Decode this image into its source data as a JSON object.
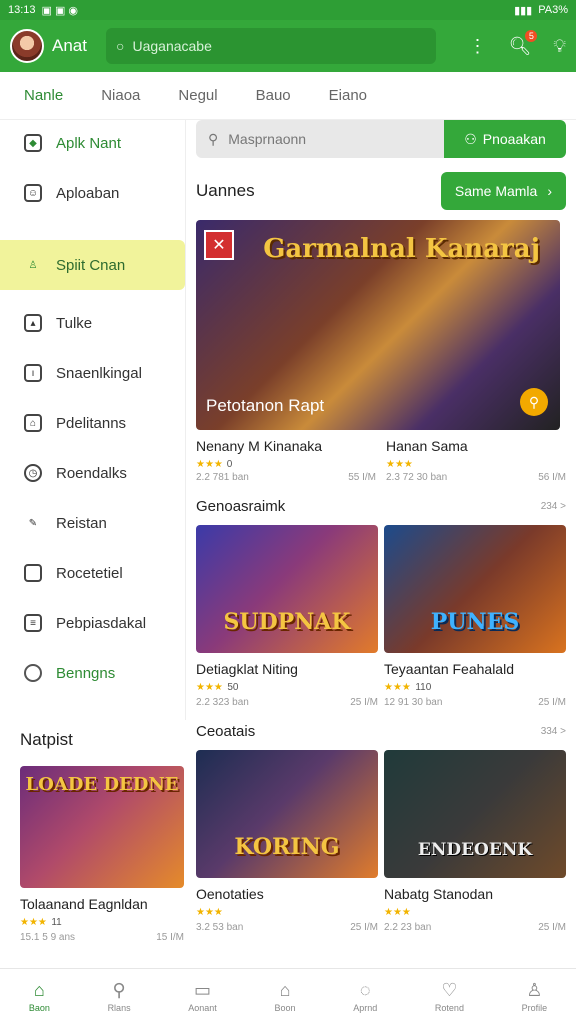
{
  "status": {
    "time": "13:13",
    "right": "PA3%"
  },
  "appbar": {
    "title": "Anat",
    "search_placeholder": "Uaganacabe",
    "notif_count": "5"
  },
  "tabs": [
    "Nanle",
    "Niaoa",
    "Negul",
    "Bauo",
    "Eiano"
  ],
  "sidebar": {
    "items": [
      {
        "label": "Aplk Nant",
        "icon": "tag-icon"
      },
      {
        "label": "Aploaban",
        "icon": "smile-box-icon"
      },
      {
        "label": "Spiit Cnan",
        "icon": "person-icon"
      },
      {
        "label": "Tulke",
        "icon": "image-icon"
      },
      {
        "label": "Snaenlkingal",
        "icon": "info-box-icon"
      },
      {
        "label": "Pdelitanns",
        "icon": "bookmark-icon"
      },
      {
        "label": "Roendalks",
        "icon": "clock-icon"
      },
      {
        "label": "Reistan",
        "icon": "pencil-icon"
      },
      {
        "label": "Rocetetiel",
        "icon": "clipboard-icon"
      },
      {
        "label": "Pebpiasdakal",
        "icon": "list-icon"
      },
      {
        "label": "Benngns",
        "icon": "circle-icon"
      }
    ]
  },
  "main": {
    "search_placeholder": "Masprnaonn",
    "search_button": "Pnoaakan",
    "section1_title": "Uannes",
    "section1_button": "Same Mamla",
    "hero": {
      "title": "Garmalnal Kanaraj",
      "caption": "Petotanon Rapt"
    },
    "hero_meta": [
      {
        "name": "Nenany M Kinanaka",
        "rating": "0",
        "downloads": "2.2 781 ban",
        "size": "55 I/M"
      },
      {
        "name": "Hanan Sama",
        "rating": "",
        "downloads": "2.3 72 30 ban",
        "size": "56 I/M"
      }
    ],
    "section2_title": "Genoasraimk",
    "section2_more": "234 >",
    "section2_cards": [
      {
        "thumb_title": "SUDPNAK",
        "name": "Detiagklat Niting",
        "rating": "50",
        "downloads": "2.2 323 ban",
        "size": "25 I/M",
        "colors": [
          "#3b3aa8",
          "#e27b2a"
        ]
      },
      {
        "thumb_title": "PUNES",
        "name": "Teyaantan Feahalald",
        "rating": "110",
        "downloads": "12 91 30 ban",
        "size": "25 I/M",
        "colors": [
          "#1c4b8c",
          "#d9731f"
        ]
      }
    ],
    "section3_title": "Ceoatais",
    "section3_more": "334 >",
    "section3_cards": [
      {
        "thumb_title": "KORING",
        "name": "Oenotaties",
        "rating": "",
        "downloads": "3.2 53 ban",
        "size": "25 I/M",
        "colors": [
          "#1d2d52",
          "#e07c2c"
        ]
      },
      {
        "thumb_title": "ENDEOENK",
        "name": "Nabatg Stanodan",
        "rating": "",
        "downloads": "2.2 23 ban",
        "size": "25 I/M",
        "colors": [
          "#203a3a",
          "#6f4a2a"
        ]
      }
    ]
  },
  "left_section": {
    "title": "Natpist",
    "card": {
      "thumb_title": "LOADE DEDNE",
      "name": "Tolaanand Eagnldan",
      "rating": "11",
      "downloads": "15.1 5 9 ans",
      "size": "15 I/M",
      "colors": [
        "#6b2c7a",
        "#e58b2a"
      ]
    }
  },
  "bottomnav": [
    {
      "label": "Baon",
      "icon": "home-icon"
    },
    {
      "label": "Rlans",
      "icon": "search-icon"
    },
    {
      "label": "Aonant",
      "icon": "wallet-icon"
    },
    {
      "label": "Boon",
      "icon": "house-icon"
    },
    {
      "label": "Aprnd",
      "icon": "chat-icon"
    },
    {
      "label": "Rotend",
      "icon": "heart-icon"
    },
    {
      "label": "Profile",
      "icon": "user-icon"
    }
  ]
}
